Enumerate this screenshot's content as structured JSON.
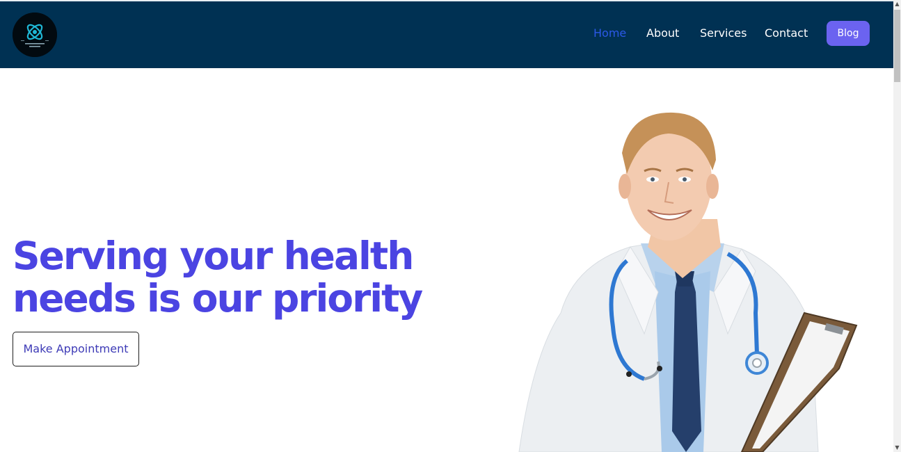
{
  "nav": {
    "links": [
      {
        "label": "Home",
        "active": true
      },
      {
        "label": "About"
      },
      {
        "label": "Services"
      },
      {
        "label": "Contact"
      }
    ],
    "blog_label": "Blog"
  },
  "hero": {
    "title_line1": "Serving your health",
    "title_line2": "needs is our priority",
    "cta_label": "Make Appointment"
  },
  "colors": {
    "navbar_bg": "#003153",
    "active_link": "#2b59e8",
    "blog_button": "#6b63f0",
    "heading": "#4b44e2"
  },
  "icons": {
    "logo": "atom-logo-icon",
    "scroll_up": "chevron-up-icon",
    "scroll_down": "chevron-down-icon"
  }
}
